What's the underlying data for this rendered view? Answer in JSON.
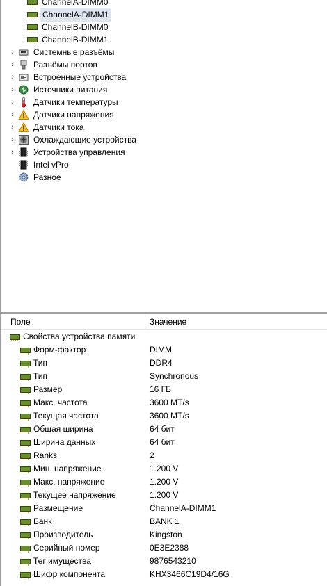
{
  "tree": {
    "items": [
      {
        "label": "ChannelA-DIMM0",
        "icon": "ram-icon",
        "expander": false,
        "selected": false
      },
      {
        "label": "ChannelA-DIMM1",
        "icon": "ram-icon",
        "expander": false,
        "selected": true
      },
      {
        "label": "ChannelB-DIMM0",
        "icon": "ram-icon",
        "expander": false,
        "selected": false
      },
      {
        "label": "ChannelB-DIMM1",
        "icon": "ram-icon",
        "expander": false,
        "selected": false
      },
      {
        "label": "Системные разъёмы",
        "icon": "slot-icon",
        "expander": true,
        "selected": false
      },
      {
        "label": "Разъёмы портов",
        "icon": "port-icon",
        "expander": true,
        "selected": false
      },
      {
        "label": "Встроенные устройства",
        "icon": "device-icon",
        "expander": true,
        "selected": false
      },
      {
        "label": "Источники питания",
        "icon": "power-icon",
        "expander": true,
        "selected": false
      },
      {
        "label": "Датчики температуры",
        "icon": "thermometer-icon",
        "expander": true,
        "selected": false
      },
      {
        "label": "Датчики напряжения",
        "icon": "warning-icon",
        "expander": true,
        "selected": false
      },
      {
        "label": "Датчики тока",
        "icon": "warning-icon",
        "expander": true,
        "selected": false
      },
      {
        "label": "Охлаждающие устройства",
        "icon": "fan-icon",
        "expander": true,
        "selected": false
      },
      {
        "label": "Устройства управления",
        "icon": "chip-icon",
        "expander": true,
        "selected": false
      },
      {
        "label": "Intel vPro",
        "icon": "chip-icon",
        "expander": false,
        "selected": false
      },
      {
        "label": "Разное",
        "icon": "gear-icon",
        "expander": false,
        "selected": false
      }
    ]
  },
  "props": {
    "header": {
      "field": "Поле",
      "value": "Значение"
    },
    "group": "Свойства устройства памяти",
    "rows": [
      {
        "name": "Форм-фактор",
        "value": "DIMM"
      },
      {
        "name": "Тип",
        "value": "DDR4"
      },
      {
        "name": "Тип",
        "value": "Synchronous"
      },
      {
        "name": "Размер",
        "value": "16 ГБ"
      },
      {
        "name": "Макс. частота",
        "value": "3600 MT/s"
      },
      {
        "name": "Текущая частота",
        "value": "3600 MT/s"
      },
      {
        "name": "Общая ширина",
        "value": "64 бит"
      },
      {
        "name": "Ширина данных",
        "value": "64 бит"
      },
      {
        "name": "Ranks",
        "value": "2"
      },
      {
        "name": "Мин. напряжение",
        "value": "1.200 V"
      },
      {
        "name": "Макс. напряжение",
        "value": "1.200 V"
      },
      {
        "name": "Текущее напряжение",
        "value": "1.200 V"
      },
      {
        "name": "Размещение",
        "value": "ChannelA-DIMM1"
      },
      {
        "name": "Банк",
        "value": "BANK 1"
      },
      {
        "name": "Производитель",
        "value": "Kingston"
      },
      {
        "name": "Серийный номер",
        "value": "0E3E2388"
      },
      {
        "name": "Тег имущества",
        "value": "9876543210"
      },
      {
        "name": "Шифр компонента",
        "value": "KHX3466C19D4/16G"
      }
    ]
  }
}
